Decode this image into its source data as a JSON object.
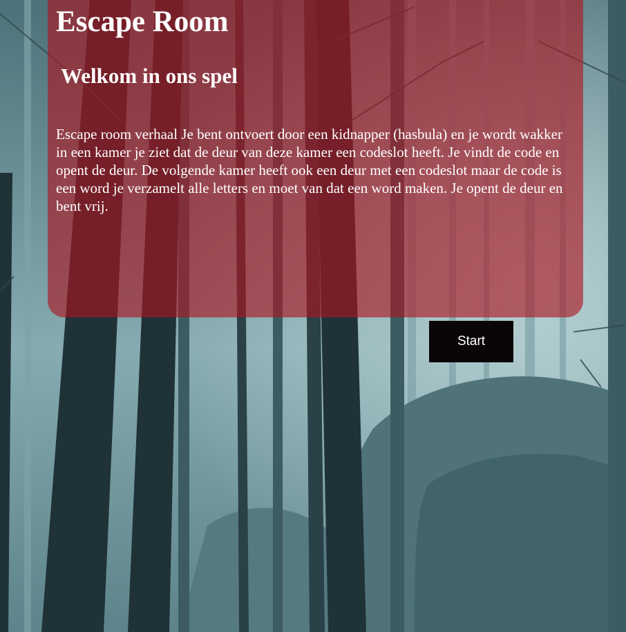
{
  "header": {
    "title": "Escape Room",
    "subtitle": "Welkom in ons spel"
  },
  "story": {
    "text": "Escape room verhaal Je bent ontvoert door een kidnapper (hasbula) en je wordt wakker in een kamer je ziet dat de deur van deze kamer een codeslot heeft. Je vindt de code en opent de deur. De volgende kamer heeft ook een deur met een codeslot maar de code is een word je verzamelt alle letters en moet van dat een word maken. Je opent de deur en bent vrij."
  },
  "actions": {
    "start_label": "Start"
  },
  "colors": {
    "panel": "#ac141e",
    "button": "#0a0506",
    "text": "#ffffff",
    "fog": "#6f9aa1"
  }
}
